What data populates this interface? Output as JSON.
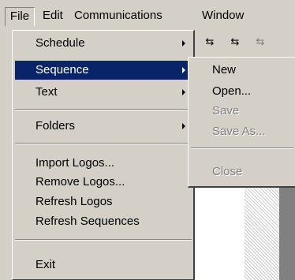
{
  "menubar": {
    "items": [
      "File",
      "Edit",
      "Communications",
      "Window"
    ]
  },
  "toolbar": {
    "icons": [
      "arrows-icon",
      "arrows-icon",
      "arrows-icon"
    ],
    "glyph": "⇆"
  },
  "file_menu": {
    "items": [
      {
        "label": "Schedule",
        "submenu": true
      },
      {
        "label": "Sequence",
        "submenu": true,
        "highlighted": true
      },
      {
        "label": "Text",
        "submenu": true
      },
      {
        "label": "Folders",
        "submenu": true
      },
      {
        "label": "Import Logos...",
        "submenu": false
      },
      {
        "label": "Remove Logos...",
        "submenu": false
      },
      {
        "label": "Refresh Logos",
        "submenu": false
      },
      {
        "label": "Refresh Sequences",
        "submenu": false
      },
      {
        "label": "Exit",
        "submenu": false
      }
    ]
  },
  "sequence_submenu": {
    "items": [
      {
        "label": "New",
        "enabled": true
      },
      {
        "label": "Open...",
        "enabled": true
      },
      {
        "label": "Save",
        "enabled": false
      },
      {
        "label": "Save As...",
        "enabled": false
      },
      {
        "label": "Close",
        "enabled": false
      }
    ]
  },
  "colors": {
    "menu_bg": "#d4d0c8",
    "highlight": "#0a246a",
    "disabled_text": "#808080"
  }
}
